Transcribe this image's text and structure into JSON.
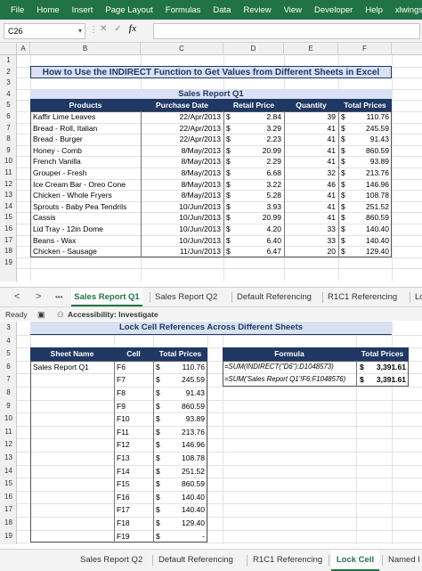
{
  "menu": [
    "File",
    "Home",
    "Insert",
    "Page Layout",
    "Formulas",
    "Data",
    "Review",
    "View",
    "Developer",
    "Help",
    "xlwings"
  ],
  "colors": {
    "excel_green": "#217346",
    "header_navy": "#1f3864",
    "title_fill": "#d9e1f2"
  },
  "formula_bar": {
    "name_box": "C26",
    "fx": "fx",
    "cancel": "✕",
    "enter": "✓"
  },
  "top_grid": {
    "columns": [
      "A",
      "B",
      "C",
      "D",
      "E",
      "F"
    ],
    "rows": [
      "1",
      "2",
      "3",
      "4",
      "5",
      "6",
      "7",
      "8",
      "9",
      "10",
      "11",
      "12",
      "13",
      "14",
      "15",
      "16",
      "17",
      "18",
      "19"
    ],
    "title": "How to Use the INDIRECT Function to Get Values from Different Sheets in Excel",
    "subtitle": "Sales Report Q1",
    "headers": [
      "Products",
      "Purchase Date",
      "Retail Price",
      "Quantity",
      "Total Prices"
    ],
    "currency": "$",
    "data": [
      {
        "product": "Kaffir Lime Leaves",
        "date": "22/Apr/2013",
        "price": "2.84",
        "qty": "39",
        "total": "110.76"
      },
      {
        "product": "Bread - Roll, Italian",
        "date": "22/Apr/2013",
        "price": "3.29",
        "qty": "41",
        "total": "245.59"
      },
      {
        "product": "Bread - Burger",
        "date": "22/Apr/2013",
        "price": "2.23",
        "qty": "41",
        "total": "91.43"
      },
      {
        "product": "Honey - Comb",
        "date": "8/May/2013",
        "price": "20.99",
        "qty": "41",
        "total": "860.59"
      },
      {
        "product": "French Vanilla",
        "date": "8/May/2013",
        "price": "2.29",
        "qty": "41",
        "total": "93.89"
      },
      {
        "product": "Grouper - Fresh",
        "date": "8/May/2013",
        "price": "6.68",
        "qty": "32",
        "total": "213.76"
      },
      {
        "product": "Ice Cream Bar - Oreo Cone",
        "date": "8/May/2013",
        "price": "3.22",
        "qty": "46",
        "total": "146.96"
      },
      {
        "product": "Chicken - Whole Fryers",
        "date": "8/May/2013",
        "price": "5.28",
        "qty": "41",
        "total": "108.78"
      },
      {
        "product": "Sprouts - Baby Pea Tendrils",
        "date": "10/Jun/2013",
        "price": "3.93",
        "qty": "41",
        "total": "251.52"
      },
      {
        "product": "Cassis",
        "date": "10/Jun/2013",
        "price": "20.99",
        "qty": "41",
        "total": "860.59"
      },
      {
        "product": "Lid Tray - 12in Dome",
        "date": "10/Jun/2013",
        "price": "4.20",
        "qty": "33",
        "total": "140.40"
      },
      {
        "product": "Beans - Wax",
        "date": "10/Jun/2013",
        "price": "6.40",
        "qty": "33",
        "total": "140.40"
      },
      {
        "product": "Chicken - Sausage",
        "date": "11/Jun/2013",
        "price": "6.47",
        "qty": "20",
        "total": "129.40"
      }
    ]
  },
  "top_tabs": {
    "nav_prev": "<",
    "nav_next": ">",
    "more": "•••",
    "items": [
      "Sales Report Q1",
      "Sales Report Q2",
      "Default Referencing",
      "R1C1 Referencing",
      "Lo"
    ],
    "active": 0
  },
  "status": {
    "ready": "Ready",
    "accessibility": "Accessibility: Investigate"
  },
  "bottom_grid": {
    "rows": [
      "3",
      "4",
      "5",
      "6",
      "7",
      "8",
      "9",
      "10",
      "11",
      "12",
      "13",
      "14",
      "15",
      "16",
      "17",
      "18",
      "19"
    ],
    "title": "Lock Cell References Across Different Sheets",
    "headers": [
      "Sheet Name",
      "Cell",
      "Total Prices"
    ],
    "sheet_name": "Sales Report Q1",
    "cells": [
      {
        "cell": "F6",
        "total": "110.76"
      },
      {
        "cell": "F7",
        "total": "245.59"
      },
      {
        "cell": "F8",
        "total": "91.43"
      },
      {
        "cell": "F9",
        "total": "860.59"
      },
      {
        "cell": "F10",
        "total": "93.89"
      },
      {
        "cell": "F11",
        "total": "213.76"
      },
      {
        "cell": "F12",
        "total": "146.96"
      },
      {
        "cell": "F13",
        "total": "108.78"
      },
      {
        "cell": "F14",
        "total": "251.52"
      },
      {
        "cell": "F15",
        "total": "860.59"
      },
      {
        "cell": "F16",
        "total": "140.40"
      },
      {
        "cell": "F17",
        "total": "140.40"
      },
      {
        "cell": "F18",
        "total": "129.40"
      },
      {
        "cell": "F19",
        "total": "-"
      }
    ],
    "formula_headers": [
      "Formula",
      "Total Prices"
    ],
    "formulas": [
      {
        "formula": "=SUM(INDIRECT(\"D6\"):D1048573)",
        "total": "3,391.61"
      },
      {
        "formula": "=SUM('Sales Report Q1'!F6:F1048576)",
        "total": "3,391.61"
      }
    ]
  },
  "bottom_tabs": {
    "items": [
      "Sales Report Q2",
      "Default Referencing",
      "R1C1 Referencing",
      "Lock Cell",
      "Named I"
    ],
    "active": 3
  }
}
